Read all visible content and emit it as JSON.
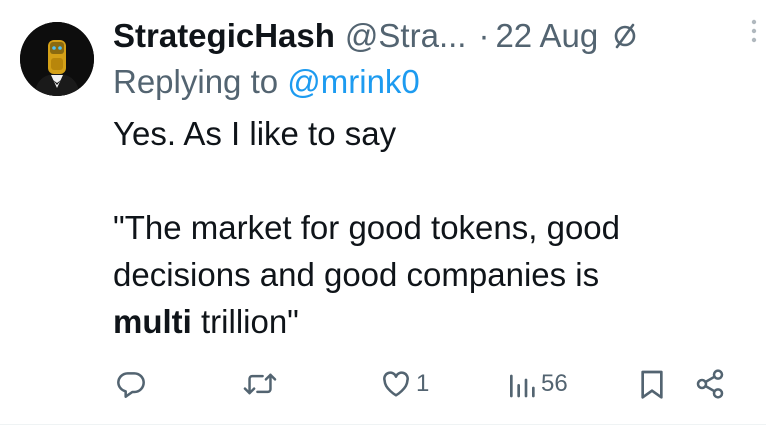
{
  "author": {
    "display_name": "StrategicHash",
    "handle": "@Stra...",
    "separator": "·",
    "date": "22 Aug"
  },
  "reply": {
    "prefix": "Replying to ",
    "handle": "@mrink0"
  },
  "body": {
    "line1": "Yes. As I like to say",
    "line2": "",
    "line3": "\"The market for good tokens, good",
    "line4": "decisions and good companies is",
    "line5_bold": "multi",
    "line5_rest": " trillion\""
  },
  "actions": {
    "replies": {
      "icon": "reply-icon",
      "count": ""
    },
    "reposts": {
      "icon": "repost-icon",
      "count": ""
    },
    "likes": {
      "icon": "heart-icon",
      "count": "1"
    },
    "views": {
      "icon": "views-icon",
      "count": "56"
    },
    "bookmark": {
      "icon": "bookmark-icon"
    },
    "share": {
      "icon": "share-icon"
    }
  },
  "colors": {
    "text": "#0f1419",
    "secondary": "#536471",
    "link": "#1d9bf0",
    "avatar_helmet": "#d4a017",
    "avatar_eyes": "#4fc3f7"
  }
}
